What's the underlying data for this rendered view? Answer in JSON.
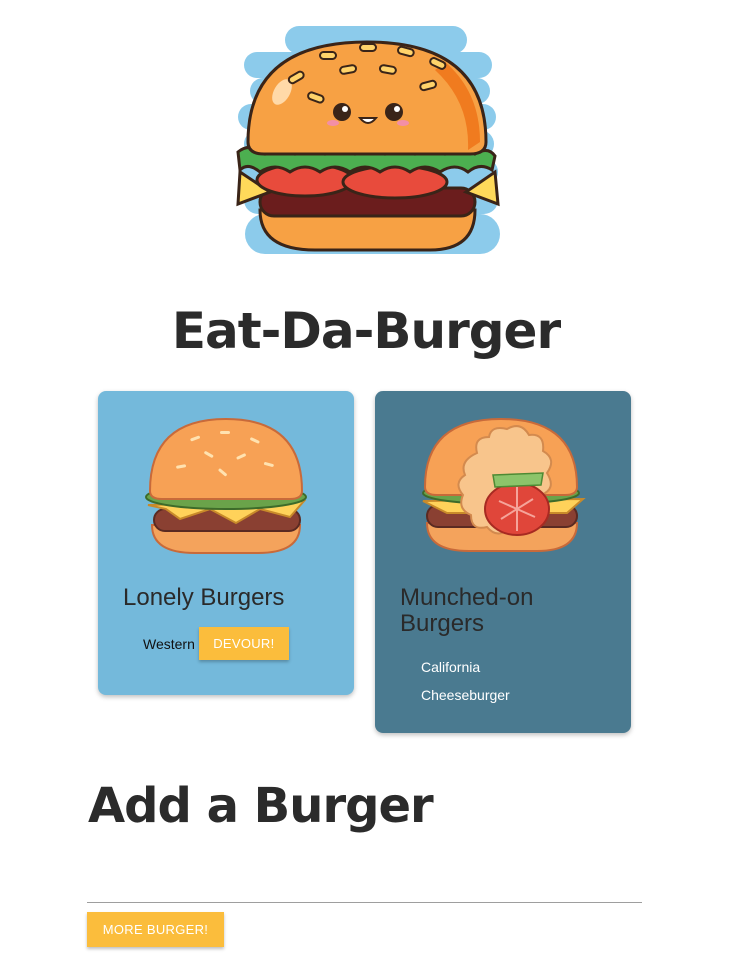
{
  "header": {
    "title": "Eat-Da-Burger"
  },
  "icons": {
    "hero": "smiling-burger-icon",
    "lonely": "whole-burger-icon",
    "munched": "bitten-burger-icon"
  },
  "colors": {
    "lonely_card": "#74b9db",
    "munched_card": "#4a7a90",
    "button": "#fbbd3c"
  },
  "lonely": {
    "title": "Lonely Burgers",
    "burgers": [
      {
        "name": "Western",
        "button_label": "DEVOUR!"
      }
    ]
  },
  "munched": {
    "title": "Munched-on Burgers",
    "burgers": [
      "California",
      "Cheeseburger"
    ]
  },
  "add": {
    "title": "Add a Burger",
    "input_value": "",
    "button_label": "MORE BURGER!"
  }
}
